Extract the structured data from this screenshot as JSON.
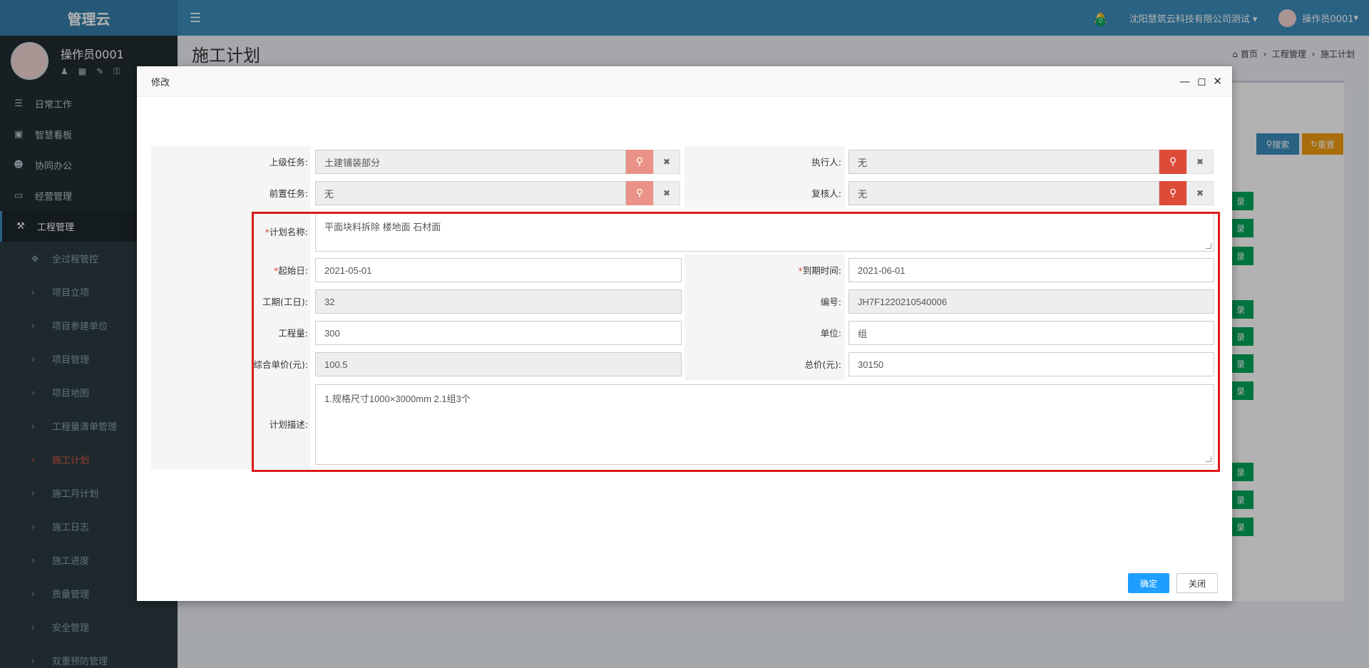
{
  "app": {
    "logo": "管理云"
  },
  "user": {
    "name": "操作员0001",
    "company": "沈阳慧筑云科技有限公司测试",
    "notifications": "0"
  },
  "sidebar": {
    "items": [
      {
        "label": "日常工作",
        "icon": "list-icon"
      },
      {
        "label": "智慧看板",
        "icon": "dashboard-icon"
      },
      {
        "label": "协同办公",
        "icon": "users-icon"
      },
      {
        "label": "经营管理",
        "icon": "desktop-icon"
      },
      {
        "label": "工程管理",
        "icon": "gavel-icon"
      }
    ],
    "subitems": [
      {
        "label": "全过程管控"
      },
      {
        "label": "项目立项"
      },
      {
        "label": "项目参建单位"
      },
      {
        "label": "项目管理"
      },
      {
        "label": "项目地图"
      },
      {
        "label": "工程量清单管理"
      },
      {
        "label": "施工计划"
      },
      {
        "label": "施工月计划"
      },
      {
        "label": "施工日志"
      },
      {
        "label": "施工进度"
      },
      {
        "label": "质量管理"
      },
      {
        "label": "安全管理"
      },
      {
        "label": "双重预防管理"
      }
    ]
  },
  "page": {
    "title": "施工计划",
    "breadcrumb": [
      "首页",
      "工程管理",
      "施工计划"
    ]
  },
  "background": {
    "search_label": "搜索",
    "reset_label": "重置",
    "row_label": "录"
  },
  "modal": {
    "title": "修改",
    "ok_label": "确定",
    "close_label": "关闭",
    "fields": {
      "parent_task": {
        "label": "上级任务:",
        "value": "土建铺装部分"
      },
      "executor": {
        "label": "执行人:",
        "value": "无"
      },
      "pre_task": {
        "label": "前置任务:",
        "value": "无"
      },
      "reviewer": {
        "label": "复核人:",
        "value": "无"
      },
      "plan_name": {
        "label": "计划名称:",
        "value": "平面块料拆除 楼地面 石材面"
      },
      "start_date": {
        "label": "起始日:",
        "value": "2021-05-01"
      },
      "end_date": {
        "label": "到期时间:",
        "value": "2021-06-01"
      },
      "duration": {
        "label": "工期(工日):",
        "value": "32"
      },
      "code": {
        "label": "编号:",
        "value": "JH7F1220210540006"
      },
      "quantity": {
        "label": "工程量:",
        "value": "300"
      },
      "unit": {
        "label": "单位:",
        "value": "组"
      },
      "unit_price": {
        "label": "综合单价(元):",
        "value": "100.5"
      },
      "total_price": {
        "label": "总价(元):",
        "value": "30150"
      },
      "description": {
        "label": "计划描述:",
        "value": "1.规格尺寸1000×3000mm  2.1组3个"
      }
    }
  },
  "colors": {
    "primary": "#3c8dbc",
    "danger": "#dd4b39",
    "confirm": "#1e9fff",
    "highlight": "#dd1a1a"
  }
}
